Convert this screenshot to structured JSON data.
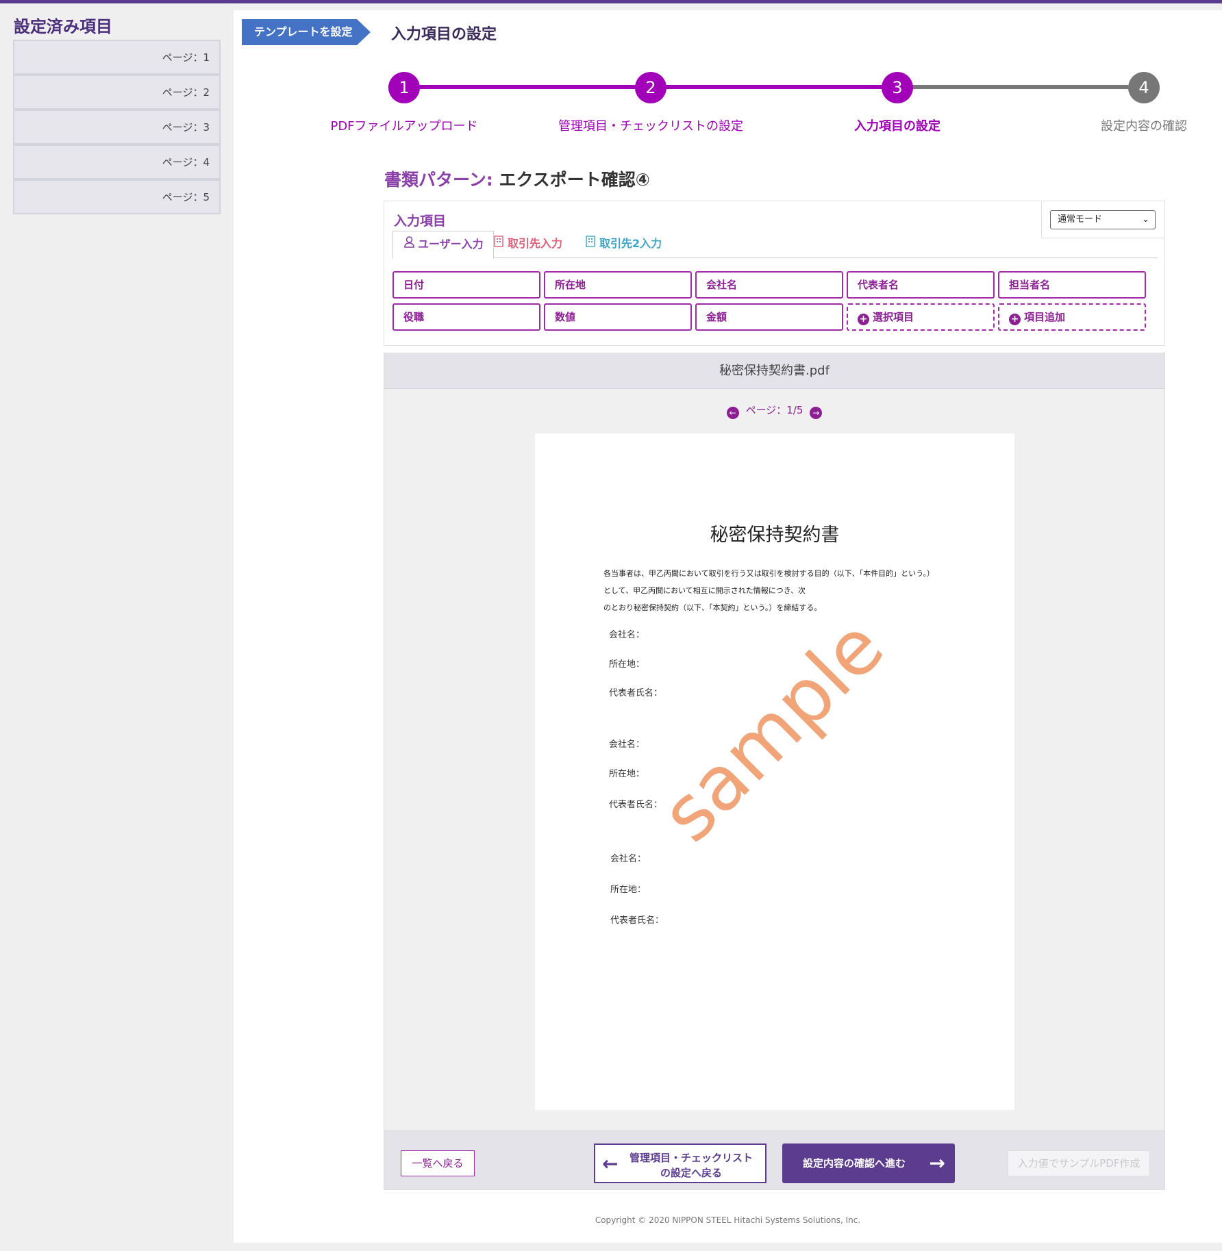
{
  "sidebar": {
    "title": "設定済み項目",
    "items": [
      "ページ：1",
      "ページ：2",
      "ページ：3",
      "ページ：4",
      "ページ：5"
    ]
  },
  "breadcrumb": {
    "tag": "テンプレートを設定",
    "title": "入力項目の設定"
  },
  "stepper": {
    "steps": [
      {
        "num": "1",
        "label": "PDFファイルアップロード",
        "state": "done"
      },
      {
        "num": "2",
        "label": "管理項目・チェックリストの設定",
        "state": "done"
      },
      {
        "num": "3",
        "label": "入力項目の設定",
        "state": "current"
      },
      {
        "num": "4",
        "label": "設定内容の確認",
        "state": "todo"
      }
    ],
    "active_color": "#a100b8",
    "inactive_color": "#777777"
  },
  "pattern": {
    "key": "書類パターン:",
    "value": "エクスポート確認④"
  },
  "input_panel": {
    "title": "入力項目",
    "mode_select": "通常モード",
    "tabs": [
      {
        "label": "ユーザー入力",
        "icon": "user-icon"
      },
      {
        "label": "取引先入力",
        "icon": "building-icon"
      },
      {
        "label": "取引先2入力",
        "icon": "building-icon"
      }
    ],
    "fields": [
      "日付",
      "所在地",
      "会社名",
      "代表者名",
      "担当者名",
      "役職",
      "数値",
      "金額"
    ],
    "add_select": "選択項目",
    "add_item": "項目追加"
  },
  "viewer": {
    "filename": "秘密保持契約書.pdf",
    "page_indicator": "ページ：1/5",
    "doc_title": "秘密保持契約書",
    "doc_lines": [
      "各当事者は、甲乙丙間において取引を行う又は取引を検討する目的（以下、「本件目的」という。）",
      "として、甲乙丙間において相互に開示された情報につき、次",
      "のとおり秘密保持契約（以下、「本契約」という。）を締結する。"
    ],
    "field_labels": [
      "会社名：",
      "所在地：",
      "代表者氏名："
    ],
    "watermark": "sample"
  },
  "footer_buttons": {
    "back": "一覧へ戻る",
    "prev_line1": "管理項目・チェックリスト",
    "prev_line2": "の設定へ戻る",
    "next": "設定内容の確認へ進む",
    "sample": "入力値でサンプルPDF作成"
  },
  "copyright": "Copyright © 2020 NIPPON STEEL Hitachi Systems Solutions, Inc."
}
